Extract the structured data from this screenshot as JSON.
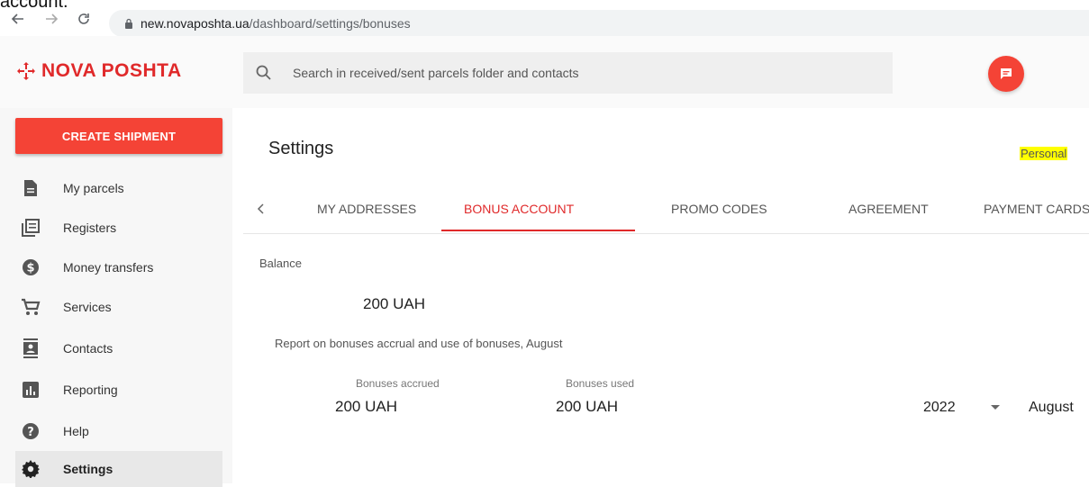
{
  "top_cut_text": "account.",
  "browser": {
    "url_host": "new.novaposhta.ua",
    "url_path": "/dashboard/settings/bonuses"
  },
  "header": {
    "logo_text": "NOVA POSHTA",
    "search_placeholder": "Search in received/sent parcels folder and contacts",
    "brand_color": "#e0292a"
  },
  "sidebar": {
    "create_label": "CREATE SHIPMENT",
    "items": [
      {
        "label": "My parcels",
        "icon": "document-icon"
      },
      {
        "label": "Registers",
        "icon": "registers-icon"
      },
      {
        "label": "Money transfers",
        "icon": "dollar-icon"
      },
      {
        "label": "Services",
        "icon": "cart-icon"
      },
      {
        "label": "Contacts",
        "icon": "contacts-icon"
      },
      {
        "label": "Reporting",
        "icon": "chart-icon"
      },
      {
        "label": "Help",
        "icon": "help-icon"
      },
      {
        "label": "Settings",
        "icon": "gear-icon",
        "active": true
      }
    ]
  },
  "main": {
    "title": "Settings",
    "personal_label": "Personal",
    "tabs": [
      {
        "label": "MY ADDRESSES"
      },
      {
        "label": "BONUS ACCOUNT",
        "active": true
      },
      {
        "label": "PROMO CODES"
      },
      {
        "label": "AGREEMENT"
      },
      {
        "label": "PAYMENT CARDS"
      }
    ],
    "balance_label": "Balance",
    "balance_value": "200 UAH",
    "report_label": "Report on bonuses accrual and use of bonuses, August",
    "accrued_label": "Bonuses accrued",
    "accrued_value": "200 UAH",
    "used_label": "Bonuses used",
    "used_value": "200 UAH",
    "year_value": "2022",
    "month_value": "August"
  }
}
